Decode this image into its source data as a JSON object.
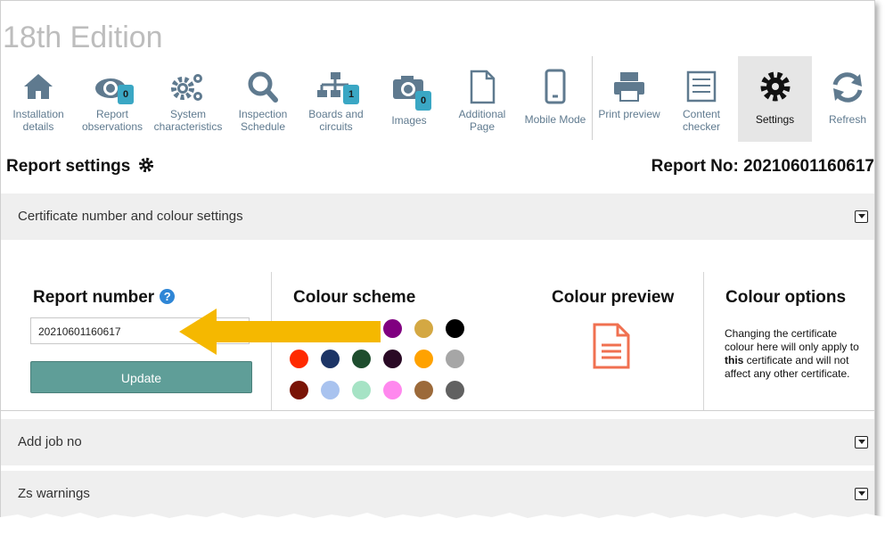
{
  "app": {
    "edition": "18th Edition"
  },
  "toolbar": {
    "items": [
      {
        "label": "Installation details",
        "icon": "house-icon"
      },
      {
        "label": "Report observations",
        "icon": "eye-icon",
        "badge": "0"
      },
      {
        "label": "System characteristics",
        "icon": "gears-icon"
      },
      {
        "label": "Inspection Schedule",
        "icon": "magnifier-icon"
      },
      {
        "label": "Boards and circuits",
        "icon": "sitemap-icon",
        "badge": "1"
      },
      {
        "label": "Images",
        "icon": "camera-icon",
        "badge": "0"
      },
      {
        "label": "Additional Page",
        "icon": "page-icon"
      },
      {
        "label": "Mobile Mode",
        "icon": "mobile-icon"
      },
      {
        "label": "Print preview",
        "icon": "printer-icon"
      },
      {
        "label": "Content checker",
        "icon": "checklist-icon"
      },
      {
        "label": "Settings",
        "icon": "gear-icon",
        "active": true
      },
      {
        "label": "Refresh",
        "icon": "refresh-icon"
      }
    ]
  },
  "header": {
    "title": "Report settings",
    "report_no": "Report No: 20210601160617"
  },
  "sections": {
    "certificate": "Certificate number and colour settings",
    "job": "Add job no",
    "zs": "Zs warnings"
  },
  "report_number": {
    "heading": "Report number",
    "help": "?",
    "value": "20210601160617",
    "update_label": "Update"
  },
  "colour_scheme": {
    "heading": "Colour scheme",
    "swatches": [
      "#800080",
      "#d4a843",
      "#000000",
      "#ff2a00",
      "#1d3566",
      "#1e4d2e",
      "#2a0a25",
      "#ffa200",
      "#a6a6a6",
      "#7a1406",
      "#a9c3ef",
      "#a6e3c5",
      "#ff88ee",
      "#9c6a3a",
      "#616161"
    ]
  },
  "colour_preview": {
    "heading": "Colour preview",
    "icon": "document-icon"
  },
  "colour_options": {
    "heading": "Colour options",
    "text_before": "Changing the certificate colour here will only apply to ",
    "text_bold": "this",
    "text_after": " certificate and will not affect any other certificate."
  },
  "colors": {
    "accent": "#5f9e98",
    "arrow": "#f5b800",
    "preview": "#f07050",
    "badge": "#3aa7c4"
  }
}
